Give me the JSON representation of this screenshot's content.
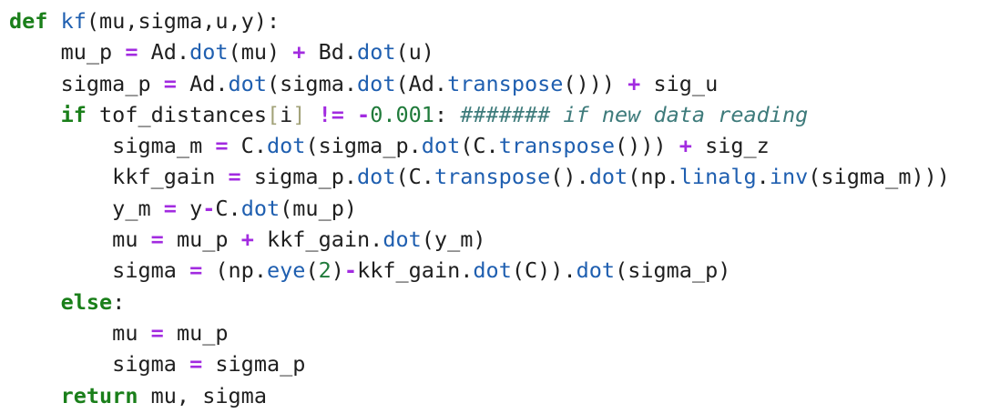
{
  "colors": {
    "keyword": "#1a7f1a",
    "function": "#1f5fb0",
    "operator": "#a22be0",
    "number": "#1f7a3a",
    "comment": "#3e7b7b",
    "bracket": "#a3a37a",
    "text": "#1f1f1f",
    "background": "#ffffff"
  },
  "code": {
    "lines": [
      [
        {
          "t": "def",
          "c": "kw"
        },
        {
          "t": " ",
          "c": "id"
        },
        {
          "t": "kf",
          "c": "fn"
        },
        {
          "t": "(mu,sigma,u,y):",
          "c": "id"
        }
      ],
      [
        {
          "t": "    mu_p ",
          "c": "id"
        },
        {
          "t": "=",
          "c": "op"
        },
        {
          "t": " Ad.",
          "c": "id"
        },
        {
          "t": "dot",
          "c": "fn"
        },
        {
          "t": "(mu) ",
          "c": "id"
        },
        {
          "t": "+",
          "c": "op"
        },
        {
          "t": " Bd.",
          "c": "id"
        },
        {
          "t": "dot",
          "c": "fn"
        },
        {
          "t": "(u)",
          "c": "id"
        }
      ],
      [
        {
          "t": "    sigma_p ",
          "c": "id"
        },
        {
          "t": "=",
          "c": "op"
        },
        {
          "t": " Ad.",
          "c": "id"
        },
        {
          "t": "dot",
          "c": "fn"
        },
        {
          "t": "(sigma.",
          "c": "id"
        },
        {
          "t": "dot",
          "c": "fn"
        },
        {
          "t": "(Ad.",
          "c": "id"
        },
        {
          "t": "transpose",
          "c": "fn"
        },
        {
          "t": "())) ",
          "c": "id"
        },
        {
          "t": "+",
          "c": "op"
        },
        {
          "t": " sig_u",
          "c": "id"
        }
      ],
      [
        {
          "t": "    ",
          "c": "id"
        },
        {
          "t": "if",
          "c": "kw"
        },
        {
          "t": " tof_distances",
          "c": "id"
        },
        {
          "t": "[",
          "c": "br"
        },
        {
          "t": "i",
          "c": "id"
        },
        {
          "t": "]",
          "c": "br"
        },
        {
          "t": " ",
          "c": "id"
        },
        {
          "t": "!=",
          "c": "op"
        },
        {
          "t": " ",
          "c": "id"
        },
        {
          "t": "-",
          "c": "op"
        },
        {
          "t": "0.001",
          "c": "num"
        },
        {
          "t": ": ",
          "c": "id"
        },
        {
          "t": "####### if new data reading",
          "c": "cm"
        }
      ],
      [
        {
          "t": "        sigma_m ",
          "c": "id"
        },
        {
          "t": "=",
          "c": "op"
        },
        {
          "t": " C.",
          "c": "id"
        },
        {
          "t": "dot",
          "c": "fn"
        },
        {
          "t": "(sigma_p.",
          "c": "id"
        },
        {
          "t": "dot",
          "c": "fn"
        },
        {
          "t": "(C.",
          "c": "id"
        },
        {
          "t": "transpose",
          "c": "fn"
        },
        {
          "t": "())) ",
          "c": "id"
        },
        {
          "t": "+",
          "c": "op"
        },
        {
          "t": " sig_z",
          "c": "id"
        }
      ],
      [
        {
          "t": "        kkf_gain ",
          "c": "id"
        },
        {
          "t": "=",
          "c": "op"
        },
        {
          "t": " sigma_p.",
          "c": "id"
        },
        {
          "t": "dot",
          "c": "fn"
        },
        {
          "t": "(C.",
          "c": "id"
        },
        {
          "t": "transpose",
          "c": "fn"
        },
        {
          "t": "().",
          "c": "id"
        },
        {
          "t": "dot",
          "c": "fn"
        },
        {
          "t": "(np.",
          "c": "id"
        },
        {
          "t": "linalg",
          "c": "fn"
        },
        {
          "t": ".",
          "c": "id"
        },
        {
          "t": "inv",
          "c": "fn"
        },
        {
          "t": "(sigma_m)))",
          "c": "id"
        }
      ],
      [
        {
          "t": "        y_m ",
          "c": "id"
        },
        {
          "t": "=",
          "c": "op"
        },
        {
          "t": " y",
          "c": "id"
        },
        {
          "t": "-",
          "c": "op"
        },
        {
          "t": "C.",
          "c": "id"
        },
        {
          "t": "dot",
          "c": "fn"
        },
        {
          "t": "(mu_p)",
          "c": "id"
        }
      ],
      [
        {
          "t": "        mu ",
          "c": "id"
        },
        {
          "t": "=",
          "c": "op"
        },
        {
          "t": " mu_p ",
          "c": "id"
        },
        {
          "t": "+",
          "c": "op"
        },
        {
          "t": " kkf_gain.",
          "c": "id"
        },
        {
          "t": "dot",
          "c": "fn"
        },
        {
          "t": "(y_m)",
          "c": "id"
        }
      ],
      [
        {
          "t": "        sigma ",
          "c": "id"
        },
        {
          "t": "=",
          "c": "op"
        },
        {
          "t": " (np.",
          "c": "id"
        },
        {
          "t": "eye",
          "c": "fn"
        },
        {
          "t": "(",
          "c": "id"
        },
        {
          "t": "2",
          "c": "num"
        },
        {
          "t": ")",
          "c": "id"
        },
        {
          "t": "-",
          "c": "op"
        },
        {
          "t": "kkf_gain.",
          "c": "id"
        },
        {
          "t": "dot",
          "c": "fn"
        },
        {
          "t": "(C)).",
          "c": "id"
        },
        {
          "t": "dot",
          "c": "fn"
        },
        {
          "t": "(sigma_p)",
          "c": "id"
        }
      ],
      [
        {
          "t": "    ",
          "c": "id"
        },
        {
          "t": "else",
          "c": "kw"
        },
        {
          "t": ":",
          "c": "id"
        }
      ],
      [
        {
          "t": "        mu ",
          "c": "id"
        },
        {
          "t": "=",
          "c": "op"
        },
        {
          "t": " mu_p",
          "c": "id"
        }
      ],
      [
        {
          "t": "        sigma ",
          "c": "id"
        },
        {
          "t": "=",
          "c": "op"
        },
        {
          "t": " sigma_p",
          "c": "id"
        }
      ],
      [
        {
          "t": "    ",
          "c": "id"
        },
        {
          "t": "return",
          "c": "kw"
        },
        {
          "t": " mu, sigma",
          "c": "id"
        }
      ]
    ]
  }
}
